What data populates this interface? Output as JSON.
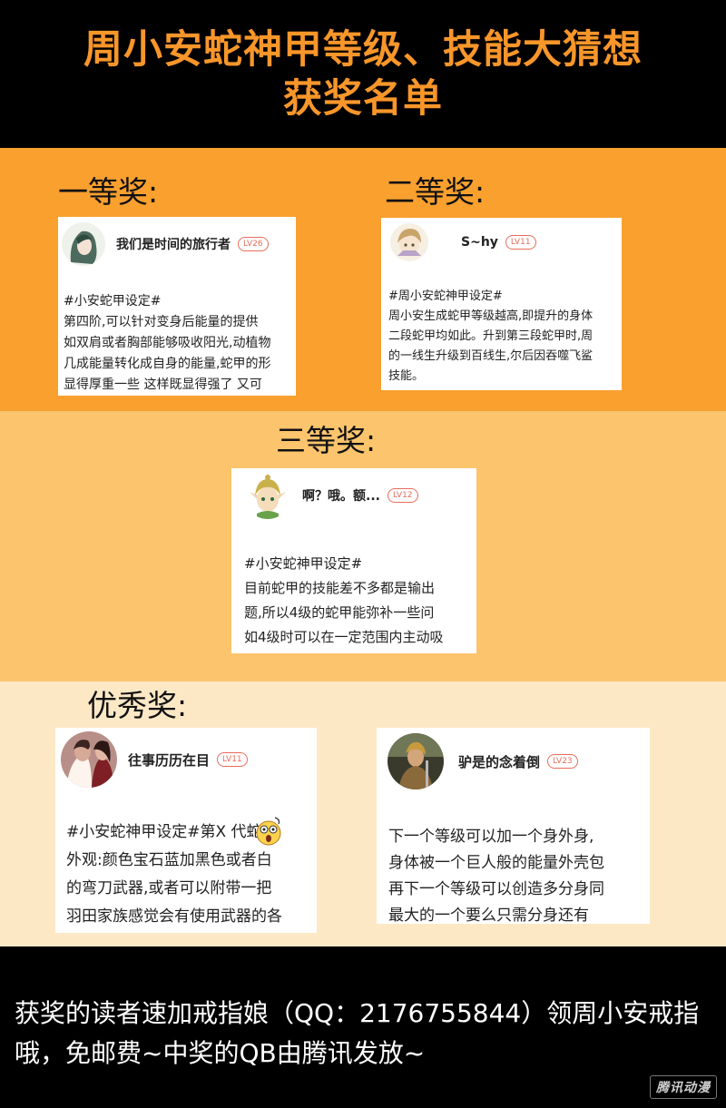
{
  "header": {
    "title_line1": "周小安蛇神甲等级、技能大猜想",
    "title_line2": "获奖名单"
  },
  "colors": {
    "title": "#f8962a",
    "band1": "#f9a02f",
    "band2": "#fcc46d",
    "band3": "#fde8c6",
    "level_badge": "#e96c5a"
  },
  "prizes": {
    "first": {
      "label": "一等奖:",
      "user": "我们是时间的旅行者",
      "level": "LV26",
      "lines": [
        "#小安蛇甲设定#",
        "  第四阶,可以针对变身后能量的提供",
        "如双肩或者胸部能够吸收阳光,动植物",
        "几成能量转化成自身的能量,蛇甲的形",
        "显得厚重一些 这样既显得强了 又可"
      ]
    },
    "second": {
      "label": "二等奖:",
      "user": "S~hy",
      "level": "LV11",
      "lines": [
        "#周小安蛇神甲设定#",
        "周小安生成蛇甲等级越高,即提升的身体",
        "二段蛇甲均如此。升到第三段蛇甲时,周",
        "的一线生升级到百线生,尔后因吞噬飞鲨",
        "技能。"
      ]
    },
    "third": {
      "label": "三等奖:",
      "user": "啊？哦。额...",
      "level": "LV12",
      "lines": [
        "#小安蛇神甲设定#",
        "目前蛇甲的技能差不多都是输出",
        "题,所以4级的蛇甲能弥补一些问",
        "如4级时可以在一定范围内主动吸"
      ]
    },
    "excellent": {
      "label": "优秀奖:",
      "entries": [
        {
          "user": "往事历历在目",
          "level": "LV11",
          "lines": [
            "#小安蛇神甲设定#第X  代蛇",
            "外观:颜色宝石蓝加黑色或者白",
            "的弯刀武器,或者可以附带一把",
            "羽田家族感觉会有使用武器的各"
          ]
        },
        {
          "user": "驴是的念着倒",
          "level": "LV23",
          "lines": [
            "下一个等级可以加一个身外身,",
            "身体被一个巨人般的能量外壳包",
            "再下一个等级可以创造多分身同",
            "最大的一个要么只需分身还有"
          ]
        }
      ]
    }
  },
  "footer": {
    "notice": "获奖的读者速加戒指娘（QQ：2176755844）领周小安戒指哦，免邮费~中奖的QB由腾讯发放~",
    "watermark": "腾讯动漫"
  },
  "icons": [
    "avatar-anime-girl",
    "avatar-chibi",
    "avatar-elf-boy",
    "avatar-couple",
    "avatar-warrior",
    "shocked-emoji-icon"
  ]
}
